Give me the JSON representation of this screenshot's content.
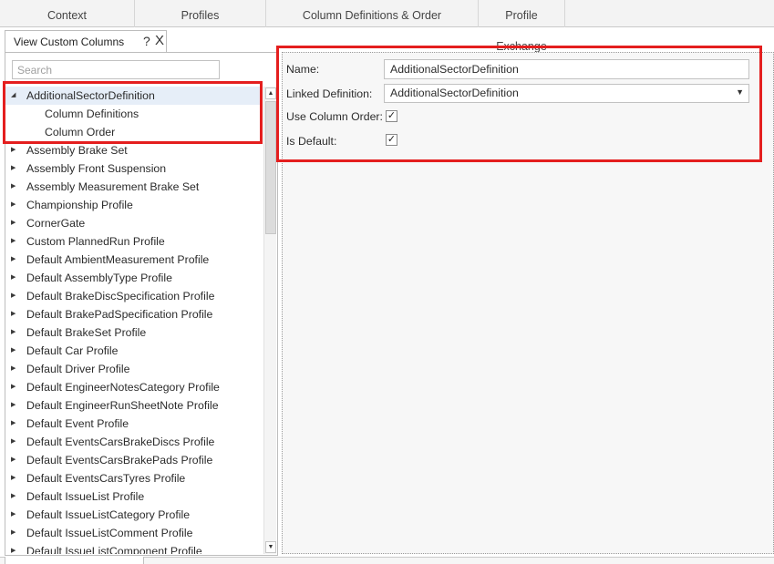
{
  "ribbon": {
    "tabs": [
      {
        "label": "Context"
      },
      {
        "label": "Profiles"
      },
      {
        "label": "Column Definitions & Order"
      },
      {
        "label": "Profile Exchange"
      }
    ]
  },
  "panel": {
    "tab_label": "View Custom Columns",
    "help_glyph": "?",
    "close_glyph": "X"
  },
  "search": {
    "placeholder": "Search",
    "value": ""
  },
  "tree": {
    "items": [
      {
        "label": "AdditionalSectorDefinition",
        "expanded": true,
        "selected": true
      },
      {
        "label": "Column Definitions",
        "child": true
      },
      {
        "label": "Column Order",
        "child": true
      },
      {
        "label": "Assembly Brake Set"
      },
      {
        "label": "Assembly Front Suspension"
      },
      {
        "label": "Assembly Measurement Brake Set"
      },
      {
        "label": "Championship Profile"
      },
      {
        "label": "CornerGate"
      },
      {
        "label": "Custom PlannedRun Profile"
      },
      {
        "label": "Default AmbientMeasurement Profile"
      },
      {
        "label": "Default AssemblyType Profile"
      },
      {
        "label": "Default BrakeDiscSpecification Profile"
      },
      {
        "label": "Default BrakePadSpecification Profile"
      },
      {
        "label": "Default BrakeSet Profile"
      },
      {
        "label": "Default Car Profile"
      },
      {
        "label": "Default Driver Profile"
      },
      {
        "label": "Default EngineerNotesCategory Profile"
      },
      {
        "label": "Default EngineerRunSheetNote Profile"
      },
      {
        "label": "Default Event Profile"
      },
      {
        "label": "Default EventsCarsBrakeDiscs Profile"
      },
      {
        "label": "Default EventsCarsBrakePads Profile"
      },
      {
        "label": "Default EventsCarsTyres Profile"
      },
      {
        "label": "Default IssueList Profile"
      },
      {
        "label": "Default IssueListCategory Profile"
      },
      {
        "label": "Default IssueListComment Profile"
      },
      {
        "label": "Default IssueListComponent Profile"
      }
    ]
  },
  "details": {
    "name_label": "Name:",
    "name_value": "AdditionalSectorDefinition",
    "linked_label": "Linked Definition:",
    "linked_value": "AdditionalSectorDefinition",
    "use_order_label": "Use Column Order:",
    "use_order_checked": true,
    "is_default_label": "Is Default:",
    "is_default_checked": true,
    "check_glyph": "✓"
  },
  "colors": {
    "highlight": "#e41e1e",
    "selection": "#e6eef8"
  }
}
